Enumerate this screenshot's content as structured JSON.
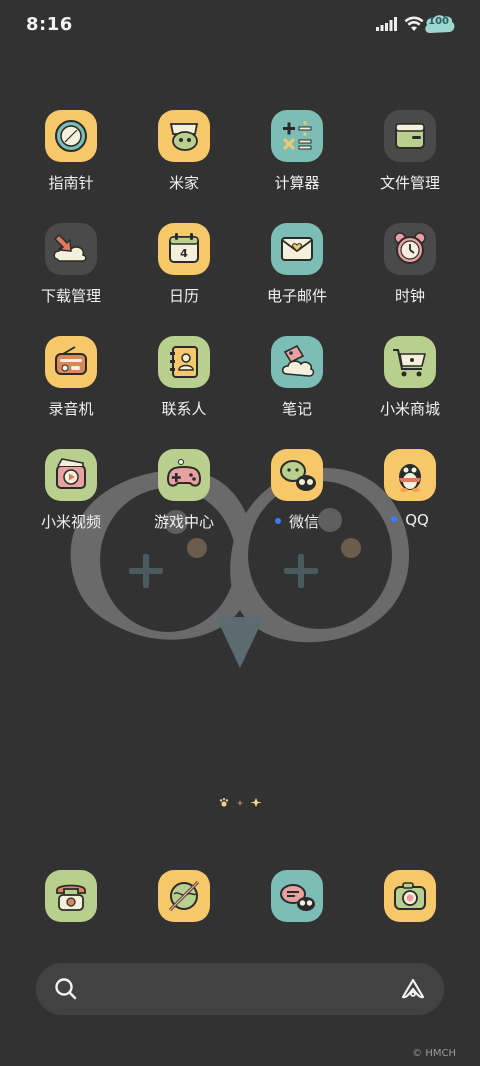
{
  "status_bar": {
    "time": "8:16",
    "battery": "100"
  },
  "apps": [
    {
      "name": "指南针",
      "icon": "compass-icon",
      "bg": "#f7c86a"
    },
    {
      "name": "米家",
      "icon": "mijia-icon",
      "bg": "#f7c86a"
    },
    {
      "name": "计算器",
      "icon": "calculator-icon",
      "bg": "#7cbdb5"
    },
    {
      "name": "文件管理",
      "icon": "folder-icon",
      "bg": "#4a4a4a"
    },
    {
      "name": "下载管理",
      "icon": "download-icon",
      "bg": "#4a4a4a"
    },
    {
      "name": "日历",
      "icon": "calendar-icon",
      "bg": "#f7c86a",
      "day": "4"
    },
    {
      "name": "电子邮件",
      "icon": "mail-icon",
      "bg": "#7cbdb5"
    },
    {
      "name": "时钟",
      "icon": "alarm-clock-icon",
      "bg": "#4a4a4a"
    },
    {
      "name": "录音机",
      "icon": "radio-icon",
      "bg": "#f7c86a"
    },
    {
      "name": "联系人",
      "icon": "contacts-icon",
      "bg": "#b9cf8d"
    },
    {
      "name": "笔记",
      "icon": "notes-icon",
      "bg": "#7cbdb5"
    },
    {
      "name": "小米商城",
      "icon": "cart-icon",
      "bg": "#b9cf8d"
    },
    {
      "name": "小米视频",
      "icon": "video-icon",
      "bg": "#b9cf8d"
    },
    {
      "name": "游戏中心",
      "icon": "gamepad-icon",
      "bg": "#b9cf8d"
    },
    {
      "name": "微信",
      "icon": "wechat-icon",
      "bg": "#f7c86a",
      "badge": true
    },
    {
      "name": "QQ",
      "icon": "qq-icon",
      "bg": "#f7c86a",
      "badge": true
    }
  ],
  "dock": [
    {
      "icon": "phone-icon",
      "bg": "#b9cf8d"
    },
    {
      "icon": "browser-icon",
      "bg": "#f7c86a"
    },
    {
      "icon": "messages-icon",
      "bg": "#7cbdb5"
    },
    {
      "icon": "camera-icon",
      "bg": "#f7c86a"
    }
  ],
  "credit": "© HMCH"
}
